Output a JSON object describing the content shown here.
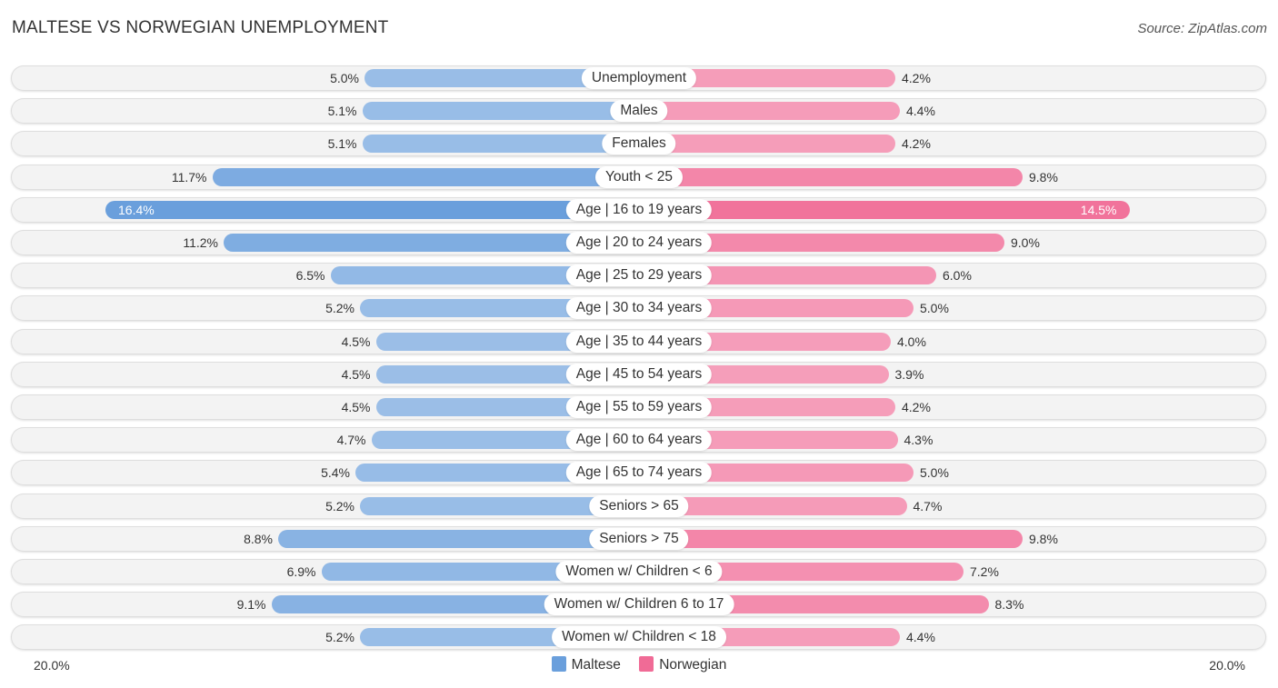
{
  "chart_data": {
    "type": "bar",
    "orientation": "horizontal-diverging",
    "title": "MALTESE VS NORWEGIAN UNEMPLOYMENT",
    "source": "Source: ZipAtlas.com",
    "categories": [
      "Unemployment",
      "Males",
      "Females",
      "Youth < 25",
      "Age | 16 to 19 years",
      "Age | 20 to 24 years",
      "Age | 25 to 29 years",
      "Age | 30 to 34 years",
      "Age | 35 to 44 years",
      "Age | 45 to 54 years",
      "Age | 55 to 59 years",
      "Age | 60 to 64 years",
      "Age | 65 to 74 years",
      "Seniors > 65",
      "Seniors > 75",
      "Women w/ Children < 6",
      "Women w/ Children 6 to 17",
      "Women w/ Children < 18"
    ],
    "series": [
      {
        "name": "Maltese",
        "color": "#6a9fdc",
        "values": [
          5.0,
          5.1,
          5.1,
          11.7,
          16.4,
          11.2,
          6.5,
          5.2,
          4.5,
          4.5,
          4.5,
          4.7,
          5.4,
          5.2,
          8.8,
          6.9,
          9.1,
          5.2
        ]
      },
      {
        "name": "Norwegian",
        "color": "#f06b96",
        "values": [
          4.2,
          4.4,
          4.2,
          9.8,
          14.5,
          9.0,
          6.0,
          5.0,
          4.0,
          3.9,
          4.2,
          4.3,
          5.0,
          4.7,
          9.8,
          7.2,
          8.3,
          4.4
        ]
      }
    ],
    "axis": {
      "left_label": "20.0%",
      "right_label": "20.0%",
      "max": 20.0
    },
    "legend": {
      "position": "bottom-center",
      "items": [
        "Maltese",
        "Norwegian"
      ]
    }
  }
}
